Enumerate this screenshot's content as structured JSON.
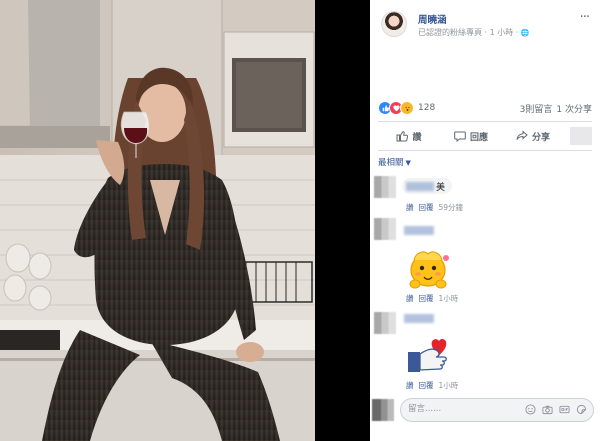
{
  "post": {
    "author": "周曉涵",
    "meta": "已認證的粉絲專頁 · 1 小時 · ",
    "globe": "🌐",
    "more": "···"
  },
  "stats": {
    "reaction_count": "128",
    "comments": "3則留言",
    "shares": "1 次分享"
  },
  "actions": {
    "like": "讚",
    "comment": "回應",
    "share": "分享"
  },
  "sort_label": "最相關",
  "comments": [
    {
      "text": "美",
      "like": "讚",
      "reply": "回覆",
      "time": "59分鐘"
    },
    {
      "text": "",
      "like": "讚",
      "reply": "回覆",
      "time": "1小時"
    },
    {
      "text": "",
      "like": "讚",
      "reply": "回覆",
      "time": "1小時"
    }
  ],
  "composer": {
    "placeholder": "留言......"
  },
  "colors": {
    "link": "#385898",
    "like": "#2d88ff",
    "love": "#f33e58",
    "wow": "#f7b928"
  },
  "icons": [
    "photo-image",
    "more-icon",
    "like-reaction-icon",
    "love-reaction-icon",
    "wow-reaction-icon",
    "like-icon",
    "comment-icon",
    "share-icon",
    "chevron-down-icon",
    "emoji-icon",
    "camera-icon",
    "gif-icon",
    "sticker-icon"
  ]
}
